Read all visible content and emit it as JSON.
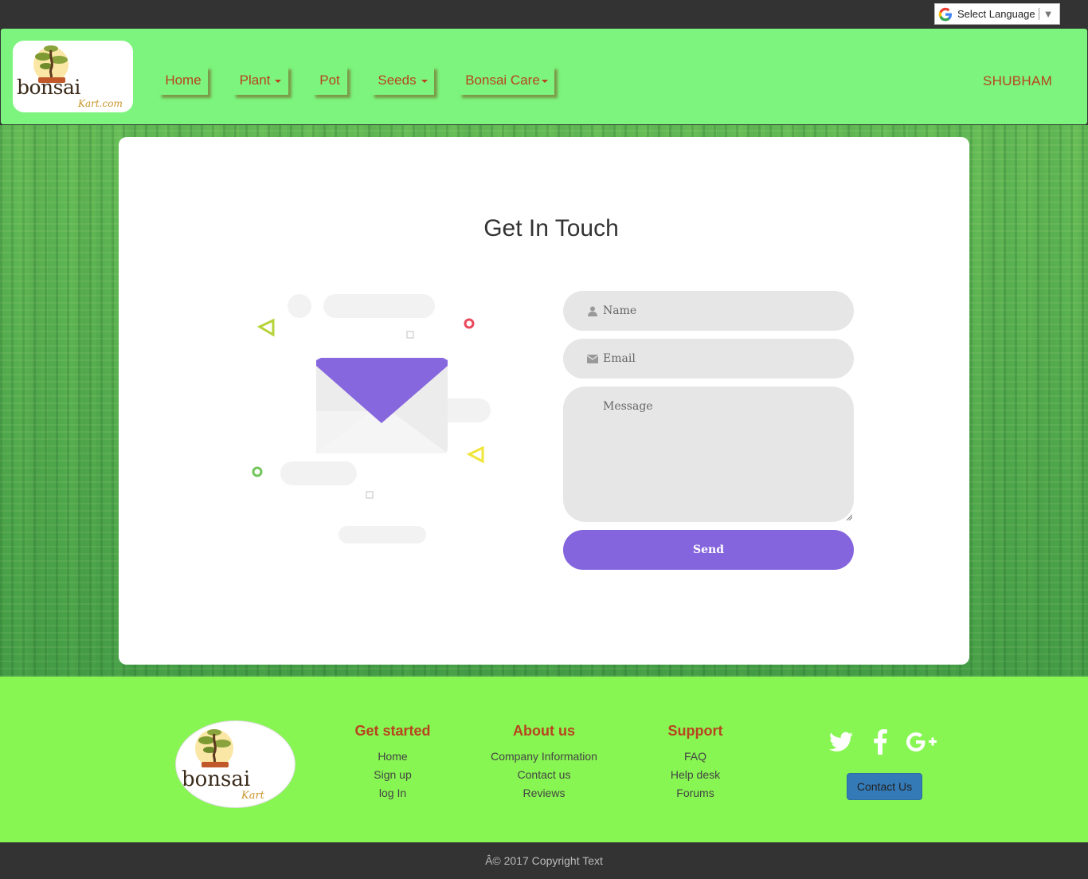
{
  "translate": {
    "label": "Select Language",
    "arrow": "▼"
  },
  "brand": {
    "word": "bonsai",
    "sub": "Kart.com"
  },
  "nav": {
    "items": [
      {
        "label": "Home",
        "dropdown": false
      },
      {
        "label": "Plant",
        "dropdown": true
      },
      {
        "label": "Pot",
        "dropdown": false
      },
      {
        "label": "Seeds",
        "dropdown": true
      },
      {
        "label": "Bonsai Care",
        "dropdown": true
      }
    ],
    "user": "SHUBHAM"
  },
  "contact": {
    "title": "Get In Touch",
    "name_placeholder": "Name",
    "email_placeholder": "Email",
    "message_placeholder": "Message",
    "send_label": "Send"
  },
  "footer": {
    "logo_word": "bonsai",
    "logo_sub": "Kart",
    "columns": [
      {
        "title": "Get started",
        "links": [
          "Home",
          "Sign up",
          "log In"
        ]
      },
      {
        "title": "About us",
        "links": [
          "Company Information",
          "Contact us",
          "Reviews"
        ]
      },
      {
        "title": "Support",
        "links": [
          "FAQ",
          "Help desk",
          "Forums"
        ]
      }
    ],
    "social": [
      "twitter-icon",
      "facebook-icon",
      "google-plus-icon"
    ],
    "contact_button": "Contact Us",
    "copyright": "Â© 2017 Copyright Text"
  },
  "colors": {
    "nav_bg": "#7cf47d",
    "accent_text": "#b8431f",
    "button_purple": "#8465dd",
    "footer_bg": "#87f552",
    "dark_bar": "#333333",
    "contact_btn": "#337ab7"
  }
}
